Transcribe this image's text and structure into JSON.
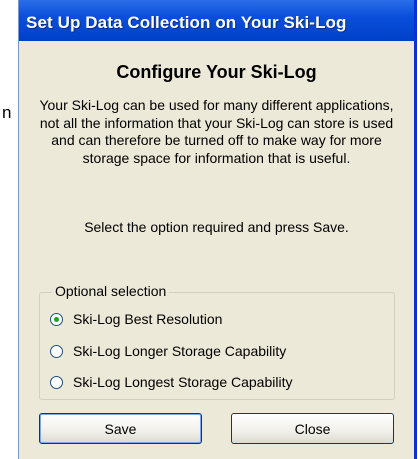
{
  "background_text": "n",
  "window": {
    "title": "Set Up Data Collection on Your Ski-Log",
    "heading": "Configure Your Ski-Log",
    "description": "Your Ski-Log can be used for many different applications, not all the information that your Ski-Log can store is used and can therefore be turned off to make way for more storage space for information that is useful.",
    "instruction": "Select the option required and press Save.",
    "group": {
      "label": "Optional selection",
      "options": [
        {
          "label": "Ski-Log Best Resolution",
          "checked": true
        },
        {
          "label": "Ski-Log Longer Storage Capability",
          "checked": false
        },
        {
          "label": "Ski-Log Longest Storage Capability",
          "checked": false
        }
      ]
    },
    "buttons": {
      "save": "Save",
      "close": "Close"
    }
  },
  "colors": {
    "titlebar": "#0a4fdb",
    "window_face": "#ece9d8",
    "radio_dot": "#21a121"
  }
}
